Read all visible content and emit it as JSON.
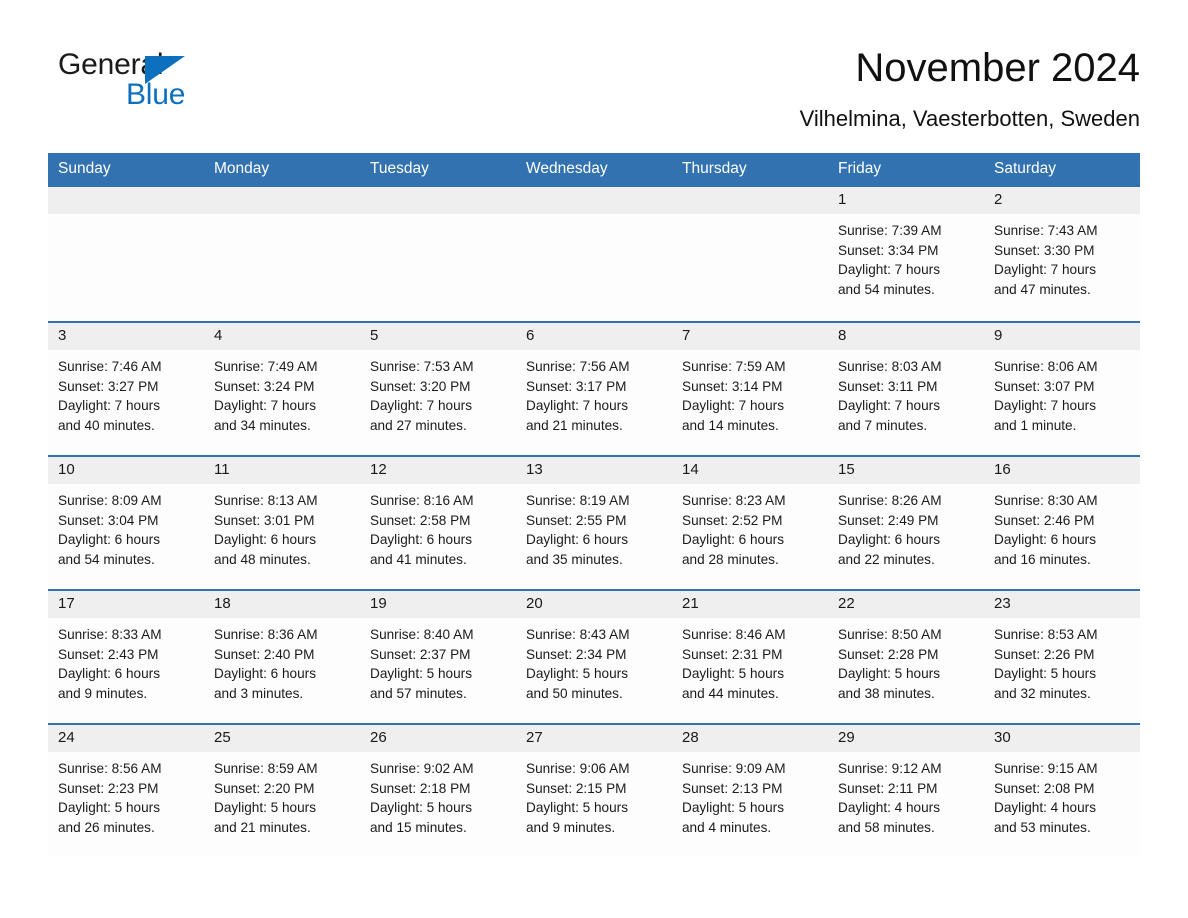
{
  "logo": {
    "word_one": "General",
    "word_two": "Blue",
    "accent_color": "#0d70bf",
    "triangle_icon": "triangle-icon"
  },
  "header": {
    "title": "November 2024",
    "subtitle": "Vilhelmina, Vaesterbotten, Sweden"
  },
  "theme": {
    "header_blue": "#3272b0",
    "day_band_gray": "#efefef",
    "text": "#1a1a1a",
    "page_background": "#ffffff"
  },
  "calendar": {
    "weekdays": [
      "Sunday",
      "Monday",
      "Tuesday",
      "Wednesday",
      "Thursday",
      "Friday",
      "Saturday"
    ],
    "weeks": [
      [
        {
          "date": "",
          "empty": true,
          "sunrise": "",
          "sunset": "",
          "daylight_line1": "",
          "daylight_line2": ""
        },
        {
          "date": "",
          "empty": true,
          "sunrise": "",
          "sunset": "",
          "daylight_line1": "",
          "daylight_line2": ""
        },
        {
          "date": "",
          "empty": true,
          "sunrise": "",
          "sunset": "",
          "daylight_line1": "",
          "daylight_line2": ""
        },
        {
          "date": "",
          "empty": true,
          "sunrise": "",
          "sunset": "",
          "daylight_line1": "",
          "daylight_line2": ""
        },
        {
          "date": "",
          "empty": true,
          "sunrise": "",
          "sunset": "",
          "daylight_line1": "",
          "daylight_line2": ""
        },
        {
          "date": "1",
          "empty": false,
          "sunrise": "Sunrise: 7:39 AM",
          "sunset": "Sunset: 3:34 PM",
          "daylight_line1": "Daylight: 7 hours",
          "daylight_line2": "and 54 minutes."
        },
        {
          "date": "2",
          "empty": false,
          "sunrise": "Sunrise: 7:43 AM",
          "sunset": "Sunset: 3:30 PM",
          "daylight_line1": "Daylight: 7 hours",
          "daylight_line2": "and 47 minutes."
        }
      ],
      [
        {
          "date": "3",
          "empty": false,
          "sunrise": "Sunrise: 7:46 AM",
          "sunset": "Sunset: 3:27 PM",
          "daylight_line1": "Daylight: 7 hours",
          "daylight_line2": "and 40 minutes."
        },
        {
          "date": "4",
          "empty": false,
          "sunrise": "Sunrise: 7:49 AM",
          "sunset": "Sunset: 3:24 PM",
          "daylight_line1": "Daylight: 7 hours",
          "daylight_line2": "and 34 minutes."
        },
        {
          "date": "5",
          "empty": false,
          "sunrise": "Sunrise: 7:53 AM",
          "sunset": "Sunset: 3:20 PM",
          "daylight_line1": "Daylight: 7 hours",
          "daylight_line2": "and 27 minutes."
        },
        {
          "date": "6",
          "empty": false,
          "sunrise": "Sunrise: 7:56 AM",
          "sunset": "Sunset: 3:17 PM",
          "daylight_line1": "Daylight: 7 hours",
          "daylight_line2": "and 21 minutes."
        },
        {
          "date": "7",
          "empty": false,
          "sunrise": "Sunrise: 7:59 AM",
          "sunset": "Sunset: 3:14 PM",
          "daylight_line1": "Daylight: 7 hours",
          "daylight_line2": "and 14 minutes."
        },
        {
          "date": "8",
          "empty": false,
          "sunrise": "Sunrise: 8:03 AM",
          "sunset": "Sunset: 3:11 PM",
          "daylight_line1": "Daylight: 7 hours",
          "daylight_line2": "and 7 minutes."
        },
        {
          "date": "9",
          "empty": false,
          "sunrise": "Sunrise: 8:06 AM",
          "sunset": "Sunset: 3:07 PM",
          "daylight_line1": "Daylight: 7 hours",
          "daylight_line2": "and 1 minute."
        }
      ],
      [
        {
          "date": "10",
          "empty": false,
          "sunrise": "Sunrise: 8:09 AM",
          "sunset": "Sunset: 3:04 PM",
          "daylight_line1": "Daylight: 6 hours",
          "daylight_line2": "and 54 minutes."
        },
        {
          "date": "11",
          "empty": false,
          "sunrise": "Sunrise: 8:13 AM",
          "sunset": "Sunset: 3:01 PM",
          "daylight_line1": "Daylight: 6 hours",
          "daylight_line2": "and 48 minutes."
        },
        {
          "date": "12",
          "empty": false,
          "sunrise": "Sunrise: 8:16 AM",
          "sunset": "Sunset: 2:58 PM",
          "daylight_line1": "Daylight: 6 hours",
          "daylight_line2": "and 41 minutes."
        },
        {
          "date": "13",
          "empty": false,
          "sunrise": "Sunrise: 8:19 AM",
          "sunset": "Sunset: 2:55 PM",
          "daylight_line1": "Daylight: 6 hours",
          "daylight_line2": "and 35 minutes."
        },
        {
          "date": "14",
          "empty": false,
          "sunrise": "Sunrise: 8:23 AM",
          "sunset": "Sunset: 2:52 PM",
          "daylight_line1": "Daylight: 6 hours",
          "daylight_line2": "and 28 minutes."
        },
        {
          "date": "15",
          "empty": false,
          "sunrise": "Sunrise: 8:26 AM",
          "sunset": "Sunset: 2:49 PM",
          "daylight_line1": "Daylight: 6 hours",
          "daylight_line2": "and 22 minutes."
        },
        {
          "date": "16",
          "empty": false,
          "sunrise": "Sunrise: 8:30 AM",
          "sunset": "Sunset: 2:46 PM",
          "daylight_line1": "Daylight: 6 hours",
          "daylight_line2": "and 16 minutes."
        }
      ],
      [
        {
          "date": "17",
          "empty": false,
          "sunrise": "Sunrise: 8:33 AM",
          "sunset": "Sunset: 2:43 PM",
          "daylight_line1": "Daylight: 6 hours",
          "daylight_line2": "and 9 minutes."
        },
        {
          "date": "18",
          "empty": false,
          "sunrise": "Sunrise: 8:36 AM",
          "sunset": "Sunset: 2:40 PM",
          "daylight_line1": "Daylight: 6 hours",
          "daylight_line2": "and 3 minutes."
        },
        {
          "date": "19",
          "empty": false,
          "sunrise": "Sunrise: 8:40 AM",
          "sunset": "Sunset: 2:37 PM",
          "daylight_line1": "Daylight: 5 hours",
          "daylight_line2": "and 57 minutes."
        },
        {
          "date": "20",
          "empty": false,
          "sunrise": "Sunrise: 8:43 AM",
          "sunset": "Sunset: 2:34 PM",
          "daylight_line1": "Daylight: 5 hours",
          "daylight_line2": "and 50 minutes."
        },
        {
          "date": "21",
          "empty": false,
          "sunrise": "Sunrise: 8:46 AM",
          "sunset": "Sunset: 2:31 PM",
          "daylight_line1": "Daylight: 5 hours",
          "daylight_line2": "and 44 minutes."
        },
        {
          "date": "22",
          "empty": false,
          "sunrise": "Sunrise: 8:50 AM",
          "sunset": "Sunset: 2:28 PM",
          "daylight_line1": "Daylight: 5 hours",
          "daylight_line2": "and 38 minutes."
        },
        {
          "date": "23",
          "empty": false,
          "sunrise": "Sunrise: 8:53 AM",
          "sunset": "Sunset: 2:26 PM",
          "daylight_line1": "Daylight: 5 hours",
          "daylight_line2": "and 32 minutes."
        }
      ],
      [
        {
          "date": "24",
          "empty": false,
          "sunrise": "Sunrise: 8:56 AM",
          "sunset": "Sunset: 2:23 PM",
          "daylight_line1": "Daylight: 5 hours",
          "daylight_line2": "and 26 minutes."
        },
        {
          "date": "25",
          "empty": false,
          "sunrise": "Sunrise: 8:59 AM",
          "sunset": "Sunset: 2:20 PM",
          "daylight_line1": "Daylight: 5 hours",
          "daylight_line2": "and 21 minutes."
        },
        {
          "date": "26",
          "empty": false,
          "sunrise": "Sunrise: 9:02 AM",
          "sunset": "Sunset: 2:18 PM",
          "daylight_line1": "Daylight: 5 hours",
          "daylight_line2": "and 15 minutes."
        },
        {
          "date": "27",
          "empty": false,
          "sunrise": "Sunrise: 9:06 AM",
          "sunset": "Sunset: 2:15 PM",
          "daylight_line1": "Daylight: 5 hours",
          "daylight_line2": "and 9 minutes."
        },
        {
          "date": "28",
          "empty": false,
          "sunrise": "Sunrise: 9:09 AM",
          "sunset": "Sunset: 2:13 PM",
          "daylight_line1": "Daylight: 5 hours",
          "daylight_line2": "and 4 minutes."
        },
        {
          "date": "29",
          "empty": false,
          "sunrise": "Sunrise: 9:12 AM",
          "sunset": "Sunset: 2:11 PM",
          "daylight_line1": "Daylight: 4 hours",
          "daylight_line2": "and 58 minutes."
        },
        {
          "date": "30",
          "empty": false,
          "sunrise": "Sunrise: 9:15 AM",
          "sunset": "Sunset: 2:08 PM",
          "daylight_line1": "Daylight: 4 hours",
          "daylight_line2": "and 53 minutes."
        }
      ]
    ]
  }
}
